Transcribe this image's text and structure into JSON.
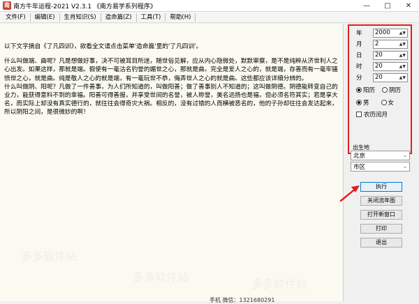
{
  "window": {
    "title": "南方牛年运程-2021  V2.3.1  《南方易学系列程序》",
    "app_icon": "南",
    "controls": {
      "minimize": "—",
      "maximize": "□",
      "close": "✕"
    }
  },
  "menu": [
    {
      "label": "文件(F)"
    },
    {
      "label": "编辑(E)"
    },
    {
      "label": "生肖知识(S)"
    },
    {
      "label": "造命篇(Z)"
    },
    {
      "label": "工具(T)"
    },
    {
      "label": "帮助(H)"
    }
  ],
  "content": {
    "paragraphs": [
      "以下文字摘自《了凡四训》，欲看全文请点击菜单'造命篇'里的'了凡四训'。",
      "什么叫做端、曲呢？凡是想做好事，决不可被耳目所迷，随世俗见解，应从内心隐微处，默默审察，是不是纯粹从济世利人之心出发。如果这样，那就是端。假使有一毫沽名钓誉的媚世之心，那就是曲。完全是爱人之心的，就是端，存善而有一毫牢骚愤世之心，就是曲。纯是敬人之心的就是端，有一毫玩世不恭，侮弄世人之心的就是曲。这些都应该详细分辨的。\n什么叫做阴、阳呢？凡做了一件善事，为人们所知道的，叫做阳善；做了善事别人不知道的；这叫做阴德。阴德能转变自己的业力，能获得意料不到的幸福。阳善可得善报，并享受世间的名誉，被人称誉，美名远扬也是福，但必须名符其实；若是享大名，而实际上却没有真实德行的，就往往会得奇灾大祸。相反的，没有过错的人而横被恶名的，他的子孙却往往会发达起来，所以阴阳之间，是很微妙的啊！"
    ]
  },
  "form": {
    "year": {
      "label": "年",
      "value": "2000"
    },
    "month": {
      "label": "月",
      "value": "2"
    },
    "day": {
      "label": "日",
      "value": "20"
    },
    "hour": {
      "label": "时",
      "value": "20"
    },
    "minute": {
      "label": "分",
      "value": "20"
    },
    "calendar": {
      "solar": "阳历",
      "lunar": "阴历",
      "selected": "solar"
    },
    "gender": {
      "male": "男",
      "female": "女",
      "selected": "male"
    },
    "leap_month": {
      "label": "农历闰月",
      "checked": false
    },
    "birthplace_label": "出生地",
    "province": "北京",
    "city": "市区"
  },
  "buttons": {
    "execute": "执行",
    "close_chart": "关闭流年图",
    "open_window": "打开新窗口",
    "print": "打印",
    "exit": "退出"
  },
  "status": {
    "text": "手机      微信：1321680291"
  },
  "watermark": "多多软件站",
  "colors": {
    "highlight_box": "#e02020",
    "arrow": "#e02020",
    "text_bg": "#fafaf0"
  }
}
